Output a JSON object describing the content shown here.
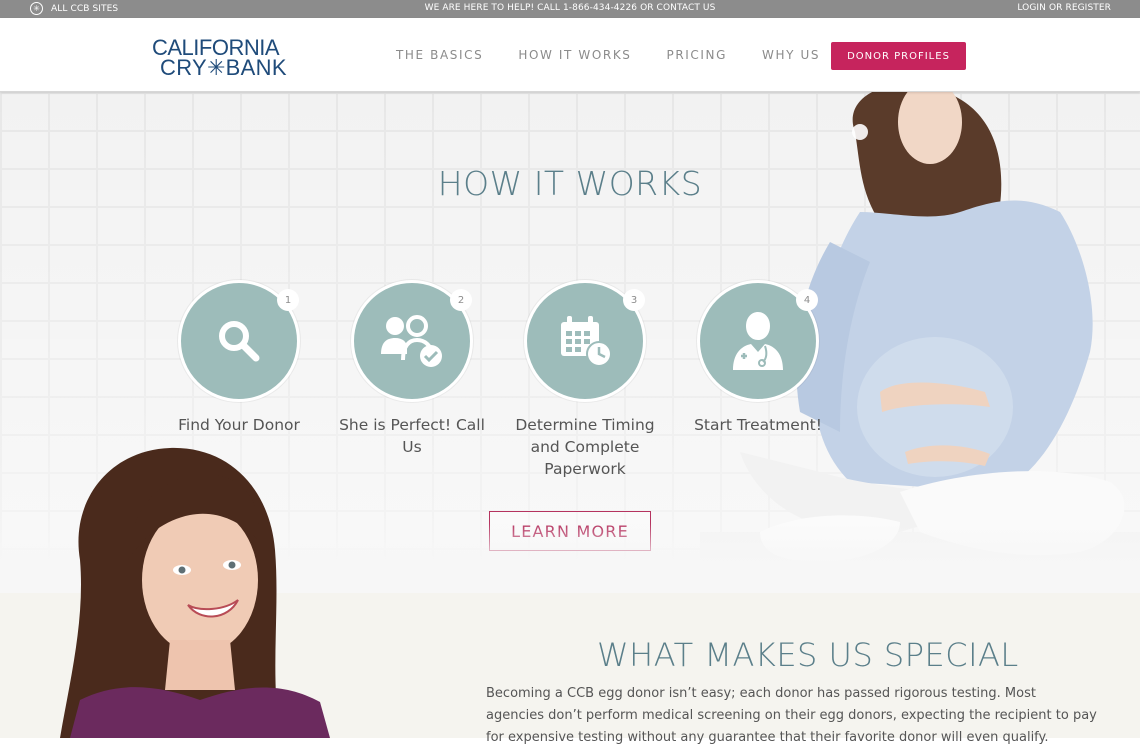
{
  "topbar": {
    "all_sites": "ALL CCB SITES",
    "help_text": "WE ARE HERE TO HELP! CALL 1-866-434-4226 OR CONTACT US",
    "login": "LOGIN OR REGISTER"
  },
  "header": {
    "logo_line1": "CALIFORNIA",
    "logo_line2": "CRY✳BANK",
    "nav": [
      "THE BASICS",
      "HOW IT WORKS",
      "PRICING",
      "WHY US"
    ],
    "donor_button": "DONOR PROFILES"
  },
  "hero": {
    "title": "HOW IT WORKS",
    "steps": [
      {
        "number": "1",
        "label": "Find Your Donor",
        "icon": "search-icon"
      },
      {
        "number": "2",
        "label": "She is Perfect! Call Us",
        "icon": "users-check-icon"
      },
      {
        "number": "3",
        "label": "Determine Timing and Complete Paperwork",
        "icon": "calendar-clock-icon"
      },
      {
        "number": "4",
        "label": "Start Treatment!",
        "icon": "doctor-icon"
      }
    ],
    "learn_more": "LEARN MORE"
  },
  "special": {
    "title": "WHAT MAKES US SPECIAL",
    "paragraph": "Becoming a CCB egg donor isn’t easy; each donor has passed rigorous testing. Most agencies don’t perform medical screening on their egg donors, expecting the recipient to pay for expensive testing without any guarantee that their favorite donor will even qualify."
  },
  "colors": {
    "accent": "#c6245d",
    "teal": "#9dbcba",
    "heading": "#5b7f8a",
    "logo": "#1f4b7a"
  }
}
